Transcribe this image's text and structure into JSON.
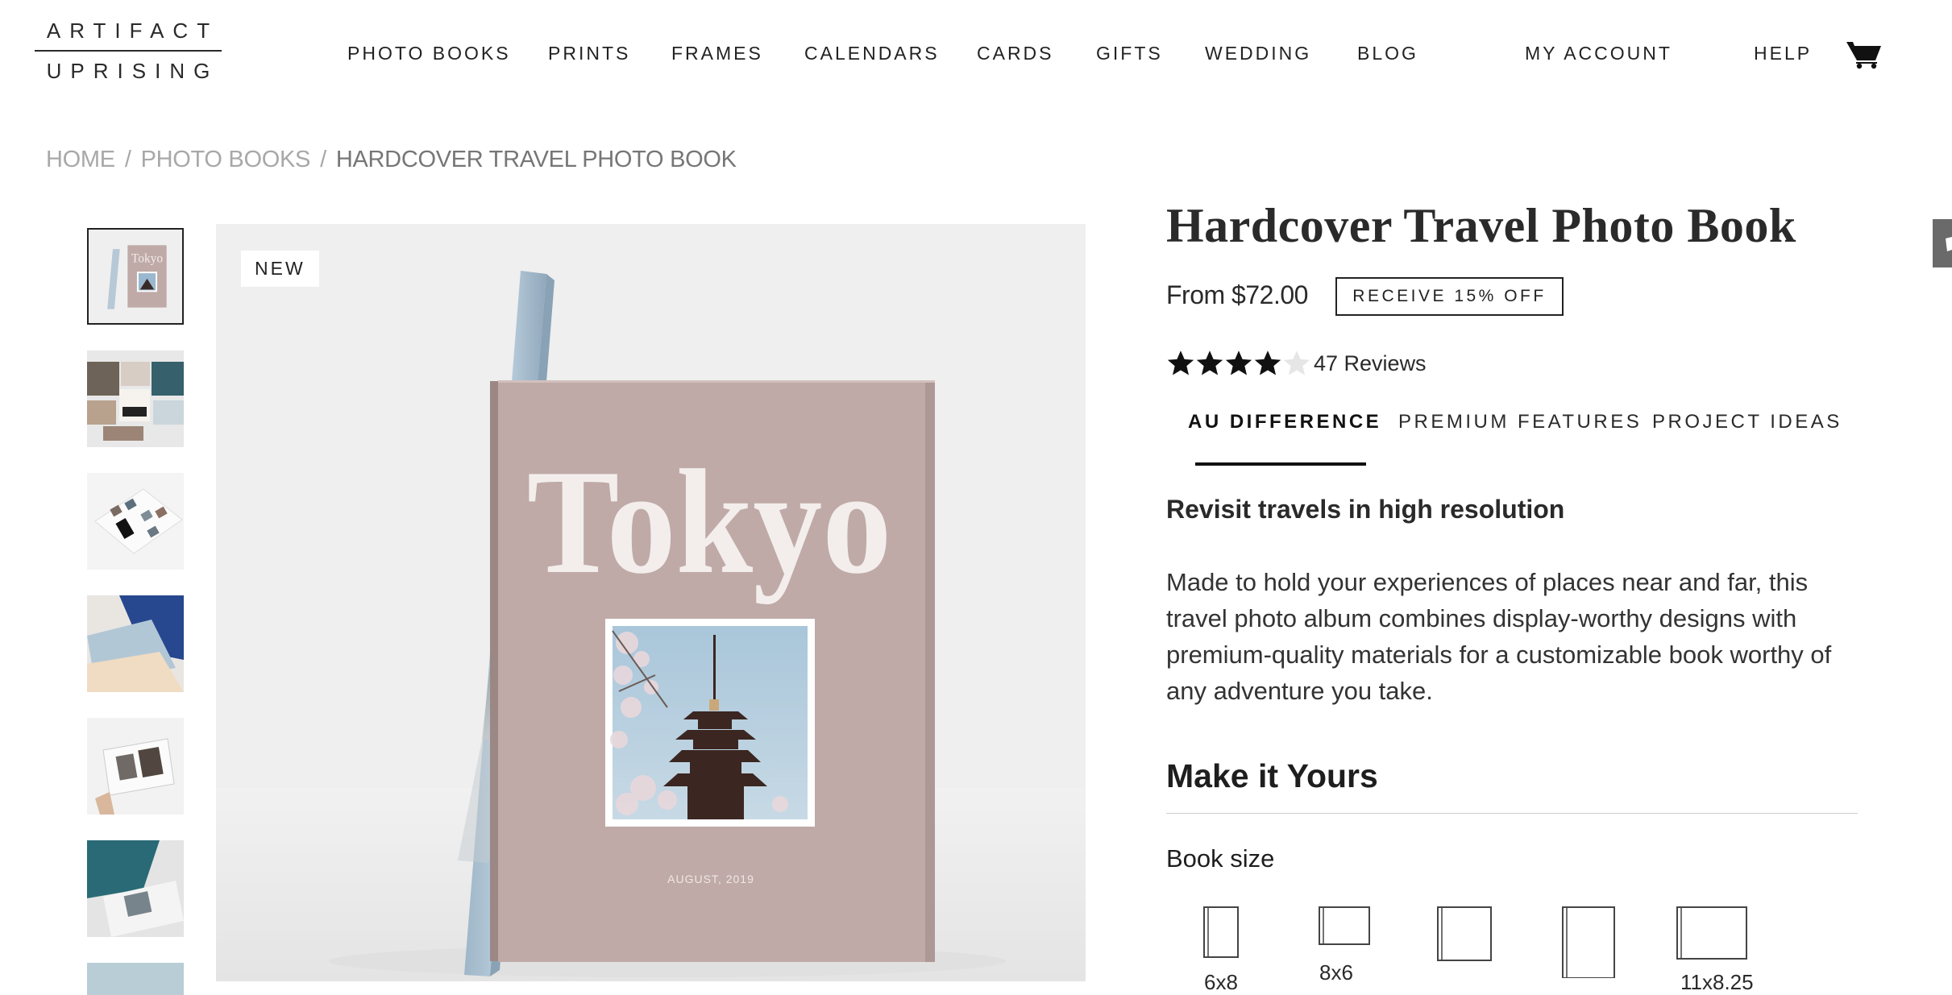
{
  "brand": {
    "line1": "ARTIFACT",
    "line2": "UPRISING"
  },
  "nav": {
    "items": [
      {
        "label": "PHOTO BOOKS"
      },
      {
        "label": "PRINTS"
      },
      {
        "label": "FRAMES"
      },
      {
        "label": "CALENDARS"
      },
      {
        "label": "CARDS"
      },
      {
        "label": "GIFTS"
      },
      {
        "label": "WEDDING"
      },
      {
        "label": "BLOG"
      }
    ],
    "account": "MY ACCOUNT",
    "help": "HELP",
    "cart_icon": "cart-icon"
  },
  "breadcrumb": {
    "items": [
      "HOME",
      "PHOTO BOOKS",
      "HARDCOVER TRAVEL PHOTO BOOK"
    ],
    "separator": "/"
  },
  "gallery": {
    "badge": "NEW",
    "cover_title": "Tokyo",
    "cover_date": "AUGUST, 2019",
    "thumbnail_count_visible": 7,
    "active_thumbnail": 1
  },
  "product": {
    "title": "Hardcover Travel Photo Book",
    "price": "From $72.00",
    "offer_button": "RECEIVE 15% OFF",
    "rating": 4,
    "rating_max": 5,
    "reviews": "47 Reviews"
  },
  "tabs": [
    {
      "label": "AU DIFFERENCE",
      "active": true
    },
    {
      "label": "PREMIUM FEATURES",
      "active": false
    },
    {
      "label": "PROJECT IDEAS",
      "active": false
    }
  ],
  "tab_content": {
    "heading": "Revisit travels in high resolution",
    "body": "Made to hold your experiences of places near and far, this travel photo album combines display-worthy designs with premium-quality materials for a customizable book worthy of any adventure you take."
  },
  "customize": {
    "heading": "Make it Yours",
    "book_size_label": "Book size",
    "sizes": [
      {
        "label": "6x8"
      },
      {
        "label": "8x6"
      },
      {
        "label": ""
      },
      {
        "label": ""
      },
      {
        "label": "11x8.25"
      }
    ]
  },
  "colors": {
    "text": "#2a2a2a",
    "muted": "#a8a8a8",
    "cover": "#bfaaa7",
    "spine": "#a9c0d3",
    "image_bg": "#efefef"
  }
}
